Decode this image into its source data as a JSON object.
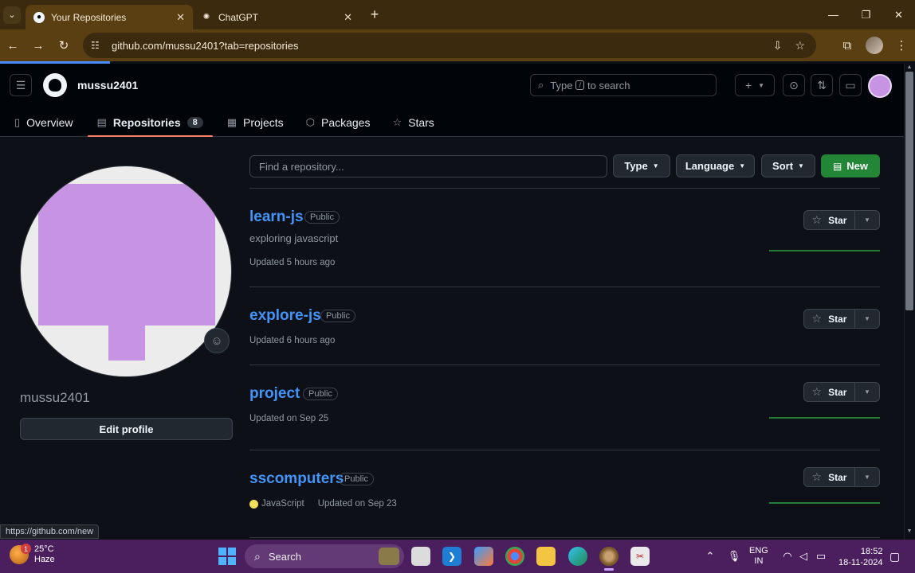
{
  "browser": {
    "tabs": [
      {
        "title": "Your Repositories",
        "active": true
      },
      {
        "title": "ChatGPT",
        "active": false
      }
    ],
    "url": "github.com/mussu2401?tab=repositories",
    "status_url": "https://github.com/new"
  },
  "header": {
    "username": "mussu2401",
    "search_prefix": "Type",
    "search_key": "/",
    "search_suffix": "to search",
    "tabs": [
      {
        "label": "Overview",
        "icon": "book-icon"
      },
      {
        "label": "Repositories",
        "icon": "repo-icon",
        "count": "8",
        "active": true
      },
      {
        "label": "Projects",
        "icon": "table-icon"
      },
      {
        "label": "Packages",
        "icon": "package-icon"
      },
      {
        "label": "Stars",
        "icon": "star-icon"
      }
    ]
  },
  "profile": {
    "name": "mussu2401",
    "edit_label": "Edit profile"
  },
  "filters": {
    "find_placeholder": "Find a repository...",
    "type_label": "Type",
    "language_label": "Language",
    "sort_label": "Sort",
    "new_label": "New"
  },
  "repos": [
    {
      "name": "learn-js",
      "visibility": "Public",
      "description": "exploring javascript",
      "updated": "Updated 5 hours ago",
      "star_label": "Star"
    },
    {
      "name": "explore-js",
      "visibility": "Public",
      "updated": "Updated 6 hours ago",
      "star_label": "Star"
    },
    {
      "name": "project",
      "visibility": "Public",
      "updated": "Updated on Sep 25",
      "star_label": "Star"
    },
    {
      "name": "sscomputers",
      "visibility": "Public",
      "language": "JavaScript",
      "updated": "Updated on Sep 23",
      "star_label": "Star"
    }
  ],
  "taskbar": {
    "weather_badge": "1",
    "temperature": "25°C",
    "condition": "Haze",
    "search_label": "Search",
    "lang_line1": "ENG",
    "lang_line2": "IN",
    "time": "18:52",
    "date": "18-11-2024"
  },
  "colors": {
    "accent_link": "#4493f8",
    "new_button": "#238636",
    "active_tab_underline": "#f78166",
    "avatar_purple": "#c694e3",
    "browser_frame": "#5a3f12",
    "taskbar": "#4b1f5e",
    "language_javascript": "#f1e05a"
  }
}
